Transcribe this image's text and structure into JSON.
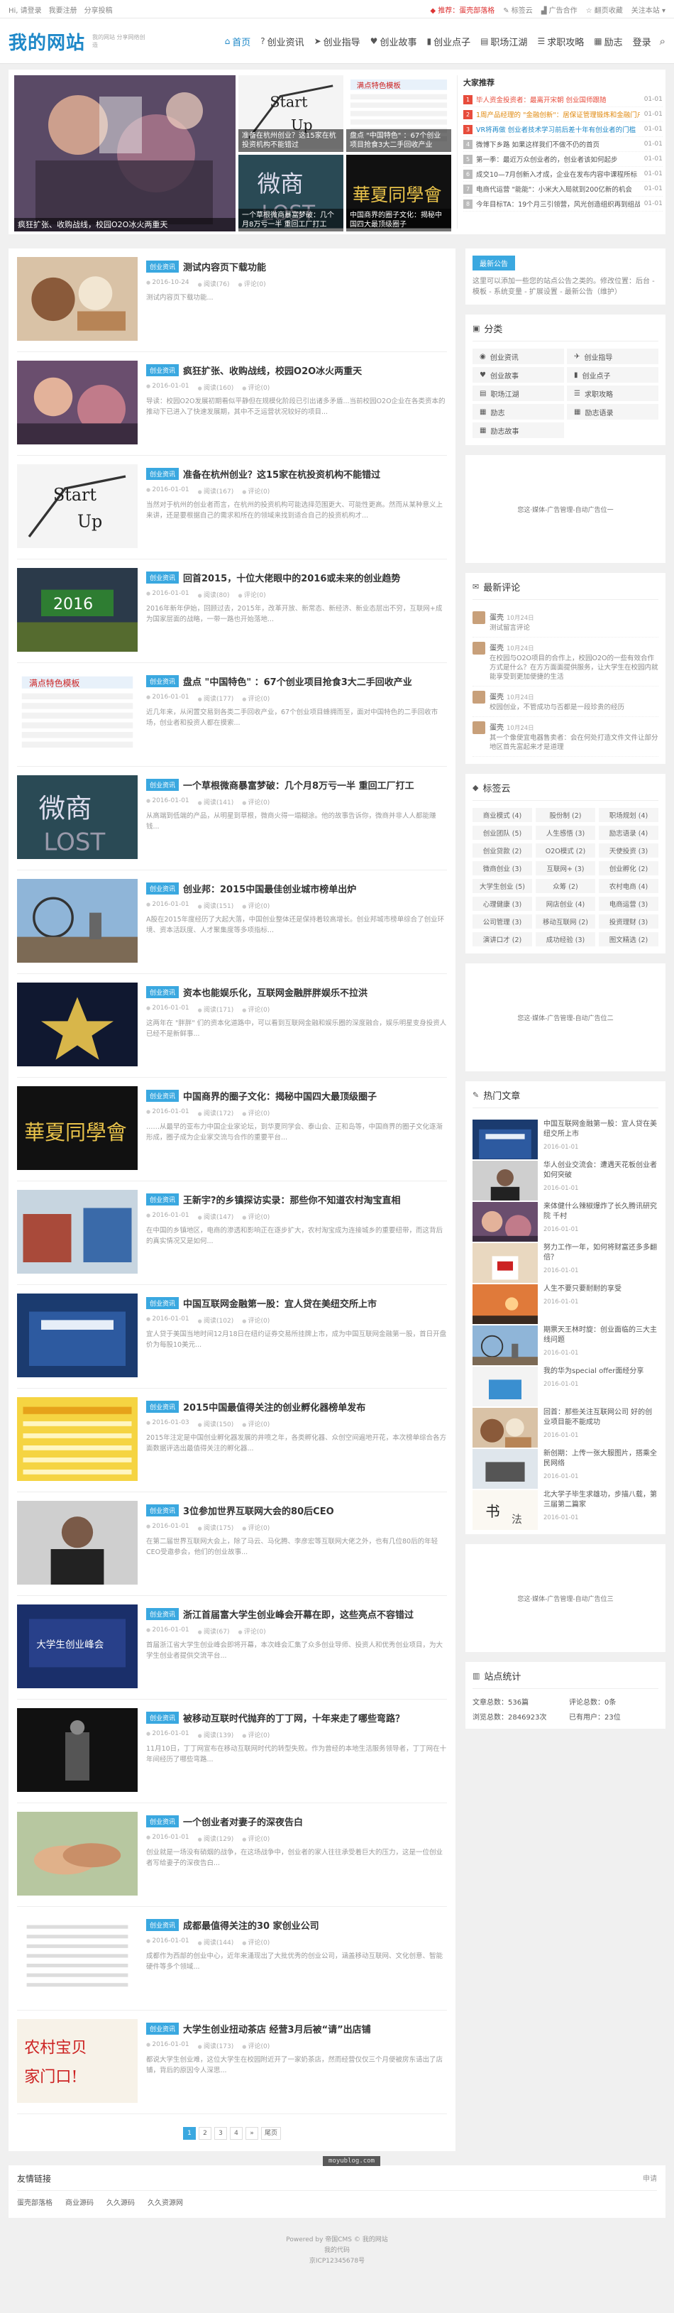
{
  "topbar": {
    "left": [
      "Hi, 请登录",
      "我要注册",
      "分享投稿"
    ],
    "right": {
      "notice": "推荐：蛋壳部落格",
      "tags": "标签云",
      "ad": "广告合作",
      "fav": "翻页收藏",
      "follow": "关注本站"
    }
  },
  "header": {
    "logo": "我的网站",
    "slogan": "我的网站 分享网络创造",
    "nav": [
      {
        "label": "首页",
        "icon": "home-icon",
        "glyph": "⌂"
      },
      {
        "label": "创业资讯",
        "icon": "question-icon",
        "glyph": "?"
      },
      {
        "label": "创业指导",
        "icon": "send-icon",
        "glyph": "➤"
      },
      {
        "label": "创业故事",
        "icon": "heart-icon",
        "glyph": "♥"
      },
      {
        "label": "创业点子",
        "icon": "bulb-icon",
        "glyph": "▮"
      },
      {
        "label": "职场江湖",
        "icon": "briefcase-icon",
        "glyph": "▤"
      },
      {
        "label": "求职攻略",
        "icon": "list-icon",
        "glyph": "☰"
      },
      {
        "label": "励志",
        "icon": "grid-icon",
        "glyph": "▦"
      },
      {
        "label": "登录",
        "icon": "user-icon",
        "glyph": ""
      }
    ],
    "search_icon": "search-icon"
  },
  "focus": {
    "big": {
      "caption": "疯狂扩张、收购战线，校园O2O冰火两重天"
    },
    "tiles": [
      {
        "caption": "准备在杭州创业？这15家在杭投资机构不能错过",
        "art": "startup"
      },
      {
        "caption": "盘点 \"中国特色\" ：67个创业项目抢食3大二手回收产业",
        "art": "table"
      },
      {
        "caption": "一个草根微商暴富梦破：几个月8万亏一半 重回工厂打工",
        "art": "weishang"
      },
      {
        "caption": "中国商界的圈子文化：揭秘中国四大最顶级圈子",
        "art": "huaxia"
      }
    ]
  },
  "hot": {
    "title": "大家推荐",
    "items": [
      {
        "n": "1",
        "title": "毕人资金投资者：最离开宋朝 创业国师跟随",
        "date": "01-01",
        "c": "c1"
      },
      {
        "n": "2",
        "title": "1周产品经理的 \"金融创新\"：居保证管理锻炼和金融门户",
        "date": "01-01",
        "c": "c2"
      },
      {
        "n": "3",
        "title": "VR将再做 创业者技术学习前后差十年有创业者的门槛",
        "date": "01-01",
        "c": "c3"
      },
      {
        "n": "4",
        "title": "微博下乡路 如果这样我们不做不仍的首页",
        "date": "01-01",
        "c": ""
      },
      {
        "n": "5",
        "title": "第一季：最近万众创业者的，创业者该如何起步",
        "date": "01-01",
        "c": ""
      },
      {
        "n": "6",
        "title": "成交10—7月创新入才成，企业在发布内容中课程所标",
        "date": "01-01",
        "c": ""
      },
      {
        "n": "7",
        "title": "电商代运营 \"能能\"：小米大入局就到200亿新的机会",
        "date": "01-01",
        "c": ""
      },
      {
        "n": "8",
        "title": "今年目标TA：19个月三引领营，风光创造组织再到组战发",
        "date": "01-01",
        "c": ""
      }
    ]
  },
  "list": {
    "tag": "创业资讯",
    "views_label": "阅读",
    "comments_label": "评论(0)",
    "items": [
      {
        "title": "测试内容页下载功能",
        "date": "2016-10-24",
        "views": "阅读(76)",
        "desc": "测试内容页下载功能...",
        "art": "food"
      },
      {
        "title": "疯狂扩张、收购战线，校园O2O冰火两重天",
        "date": "2016-01-01",
        "views": "阅读(160)",
        "desc": "导读：校园O2O发展初期看似平静但在规模化阶段已引出诸多矛盾...当前校园O2O企业在各类资本的推动下已进入了快速发展期，其中不乏运营状况较好的项目...",
        "art": "party"
      },
      {
        "title": "准备在杭州创业？这15家在杭投资机构不能错过",
        "date": "2016-01-01",
        "views": "阅读(167)",
        "desc": "当然对于杭州的创业者而言，在杭州的投资机构可能选择范围更大、可能性更高。然而从某种意义上来讲，还是要根据自己的需求和所在的领域来找到适合自己的投资机构才...",
        "art": "startup"
      },
      {
        "title": "回首2015，十位大佬眼中的2016或未来的创业趋势",
        "date": "2016-01-01",
        "views": "阅读(80)",
        "desc": "2016年新年伊始，回顾过去，2015年，改革开放、新常态、新经济、新业态层出不穷，互联网+成为国家层面的战略，一带一路也开始落地...",
        "art": "y2016"
      },
      {
        "title": "盘点 \"中国特色\" ：67个创业项目抢食3大二手回收产业",
        "date": "2016-01-01",
        "views": "阅读(177)",
        "desc": "近几年来，从闲置交易到各类二手回收产业，67个创业项目蜂拥而至，面对中国特色的二手回收市场，创业者和投资人都在摸索...",
        "art": "table"
      },
      {
        "title": "一个草根微商暴富梦破：几个月8万亏一半 重回工厂打工",
        "date": "2016-01-01",
        "views": "阅读(141)",
        "desc": "从高端到低端的产品，从明星到草根，微商火得一塌糊涂。他的故事告诉你，微商并非人人都能赚钱...",
        "art": "weishang"
      },
      {
        "title": "创业邦：2015中国最佳创业城市榜单出炉",
        "date": "2016-01-01",
        "views": "阅读(151)",
        "desc": "A股在2015年度经历了大起大落，中国创业整体还是保持着较高增长。创业邦城市榜单综合了创业环境、资本活跃度、人才聚集度等多项指标...",
        "art": "city"
      },
      {
        "title": "资本也能娱乐化，互联网金融胖胖娱乐不拉洪",
        "date": "2016-01-01",
        "views": "阅读(171)",
        "desc": "这两年在 \"胖胖\" 们的资本化道路中，可以看到互联网金融和娱乐圈的深度融合，娱乐明星变身投资人已经不是新鲜事...",
        "art": "star"
      },
      {
        "title": "中国商界的圈子文化：揭秘中国四大最顶级圈子",
        "date": "2016-01-01",
        "views": "阅读(172)",
        "desc": "……从最早的亚布力中国企业家论坛，到华夏同学会、泰山会、正和岛等，中国商界的圈子文化逐渐形成，圈子成为企业家交流与合作的重要平台...",
        "art": "huaxia"
      },
      {
        "title": "王新宇?的乡镇探访实录：那些你不知道农村淘宝直相",
        "date": "2016-01-01",
        "views": "阅读(147)",
        "desc": "在中国的乡镇地区，电商的渗透和影响正在逐步扩大，农村淘宝成为连接城乡的重要纽带，而这背后的真实情况又是如何...",
        "art": "village"
      },
      {
        "title": "中国互联网金融第一股：宜人贷在美纽交所上市",
        "date": "2016-01-01",
        "views": "阅读(102)",
        "desc": "宜人贷于美国当地时间12月18日在纽约证券交易所挂牌上市，成为中国互联网金融第一股，首日开盘价为每股10美元...",
        "art": "nyse"
      },
      {
        "title": "2015中国最值得关注的创业孵化器榜单发布",
        "date": "2016-01-03",
        "views": "阅读(150)",
        "desc": "2015年注定是中国创业孵化器发展的井喷之年，各类孵化器、众创空间遍地开花，本次榜单综合各方面数据评选出最值得关注的孵化器...",
        "art": "chart"
      },
      {
        "title": "3位参加世界互联网大会的80后CEO",
        "date": "2016-01-01",
        "views": "阅读(175)",
        "desc": "在第二届世界互联网大会上，除了马云、马化腾、李彦宏等互联网大佬之外，也有几位80后的年轻CEO受邀参会，他们的创业故事...",
        "art": "ceo"
      },
      {
        "title": "浙江首届富大学生创业峰会开幕在即，这些亮点不容错过",
        "date": "2016-01-01",
        "views": "阅读(67)",
        "desc": "首届浙江省大学生创业峰会即将开幕，本次峰会汇集了众多创业导师、投资人和优秀创业项目，为大学生创业者提供交流平台...",
        "art": "summit"
      },
      {
        "title": "被移动互联时代抛弃的丁丁网，十年来走了哪些弯路？",
        "date": "2016-01-01",
        "views": "阅读(139)",
        "desc": "11月10日，丁丁网宣布在移动互联网时代的转型失败。作为曾经的本地生活服务领导者，丁丁网在十年间经历了哪些弯路...",
        "art": "dark"
      },
      {
        "title": "一个创业者对妻子的深夜告白",
        "date": "2016-01-01",
        "views": "阅读(129)",
        "desc": "创业就是一场没有硝烟的战争，在这场战争中，创业者的家人往往承受着巨大的压力，这是一位创业者写给妻子的深夜告白...",
        "art": "hands"
      },
      {
        "title": "成都最值得关注的30 家创业公司",
        "date": "2016-01-01",
        "views": "阅读(144)",
        "desc": "成都作为西部的创业中心，近年来涌现出了大批优秀的创业公司，涵盖移动互联网、文化创意、智能硬件等多个领域...",
        "art": "doc"
      },
      {
        "title": "大学生创业扭动茶店 经营3月后被“请”出店铺",
        "date": "2016-01-01",
        "views": "阅读(173)",
        "desc": "都说大学生创业难，这位大学生在校园附近开了一家奶茶店，然而经营仅仅三个月便被房东请出了店铺，背后的原因令人深思...",
        "art": "shop"
      }
    ]
  },
  "pager": [
    "1",
    "2",
    "3",
    "4",
    "»",
    "尾页"
  ],
  "side": {
    "notice": {
      "btn": "最新公告",
      "text": "这里可以添加一些您的站点公告之类的。修改位置：后台 - 模板 - 系统变量 - 扩展设置 - 最新公告（维护）"
    },
    "cats": {
      "title": "分类",
      "items": [
        "创业资讯",
        "创业指导",
        "创业故事",
        "创业点子",
        "职场江湖",
        "求职攻略",
        "励志",
        "励志语录",
        "励志故事"
      ]
    },
    "ad_text": "您这·媒体-广告管理-自动广告位一",
    "ad2_text": "您这·媒体-广告管理-自动广告位二",
    "ad3_text": "您这·媒体-广告管理-自动广告位三",
    "comments": {
      "title": "最新评论",
      "items": [
        {
          "who": "蛋壳",
          "when": "10月24日",
          "txt": "测试留言评论"
        },
        {
          "who": "蛋壳",
          "when": "10月24日",
          "txt": "在校园与O2O项目的合作上，校园O2O的一些有效合作方式是什么？在方方面面提供服务，让大学生在校园内就能享受到更加便捷的生活"
        },
        {
          "who": "蛋壳",
          "when": "10月24日",
          "txt": "校园创业，不管成功与否都是一段珍贵的经历"
        },
        {
          "who": "蛋壳",
          "when": "10月24日",
          "txt": "其一个像便宜电器售卖者：会在何处打造文件文件让部分地区首先富起来才是道理"
        }
      ]
    },
    "tags": {
      "title": "标签云",
      "items": [
        "商业模式 (4)",
        "股份制 (2)",
        "职场规划 (4)",
        "创业团队 (5)",
        "人生感悟 (3)",
        "励志语录 (4)",
        "创业贷款 (2)",
        "O2O模式 (2)",
        "天使投资 (3)",
        "微商创业 (3)",
        "互联网+ (3)",
        "创业孵化 (2)",
        "大学生创业 (5)",
        "众筹 (2)",
        "农村电商 (4)",
        "心理健康 (3)",
        "网店创业 (4)",
        "电商运营 (3)",
        "公司管理 (3)",
        "移动互联网 (2)",
        "投资理财 (3)",
        "演讲口才 (2)",
        "成功经验 (3)",
        "图文精选 (2)"
      ]
    },
    "hotposts": {
      "title": "热门文章",
      "items": [
        {
          "title": "中国互联网金融第一股：宜人贷在美纽交所上市",
          "date": "2016-01-01",
          "art": "nyse"
        },
        {
          "title": "华人创业交流会：遭遇天花板创业者如何突破",
          "date": "2016-01-01",
          "art": "ceo"
        },
        {
          "title": "来体健什么辣椒爆炸了长久腾讯研究院 千村",
          "date": "2016-01-01",
          "art": "party"
        },
        {
          "title": "努力工作一年，如何将财富还多多翻倍？",
          "date": "2016-01-01",
          "art": "cup"
        },
        {
          "title": "人生不要只要耐耐的享受",
          "date": "2016-01-01",
          "art": "sunset"
        },
        {
          "title": "期票天王林时旋：创业面临的三大主线问题",
          "date": "2016-01-01",
          "art": "city"
        },
        {
          "title": "我的华为special offer面经分享",
          "date": "2016-01-01",
          "art": "logo"
        },
        {
          "title": "回首：那些关注互联网公司 好的创业项目能不能成功",
          "date": "2016-01-01",
          "art": "food"
        },
        {
          "title": "新创期：上传一张大服图片，搭乘全民网络",
          "date": "2016-01-01",
          "art": "desk"
        },
        {
          "title": "北大学子毕生求雄功，步描八载，第三届第二篇家",
          "date": "2016-01-01",
          "art": "calli"
        }
      ]
    },
    "stats": {
      "title": "站点统计",
      "items": [
        "文章总数：536篇",
        "评论总数：0条",
        "浏览总数：2846923次",
        "已有用户：23位"
      ]
    }
  },
  "links": {
    "title": "友情链接",
    "apply": "申请",
    "items": [
      "蛋壳部落格",
      "商业源码",
      "久久源码",
      "久久资源网"
    ]
  },
  "footer": {
    "line1": "Powered by 帝国CMS © 我的网站",
    "line2": "我的代码",
    "line3": "京ICP12345678号"
  },
  "watermark": "moyublog.com",
  "colors": {
    "accent": "#1e88c8",
    "tag": "#3aa8e0",
    "red": "#e74c3c"
  }
}
